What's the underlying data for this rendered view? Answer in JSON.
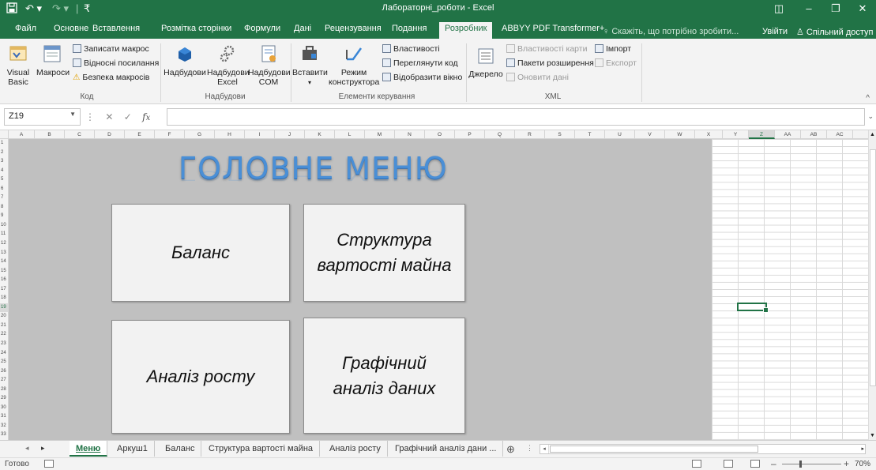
{
  "titlebar": {
    "title": "Лабораторні_роботи - Excel",
    "controls": [
      "◫",
      "–",
      "❐",
      "✕"
    ]
  },
  "tabs": [
    {
      "label": "Файл"
    },
    {
      "label": "Основне"
    },
    {
      "label": "Вставлення"
    },
    {
      "label": "Розмітка сторінки"
    },
    {
      "label": "Формули"
    },
    {
      "label": "Дані"
    },
    {
      "label": "Рецензування"
    },
    {
      "label": "Подання"
    },
    {
      "label": "Розробник",
      "active": true
    },
    {
      "label": "ABBYY PDF Transformer+"
    }
  ],
  "tell_me": "Скажіть, що потрібно зробити...",
  "sign_in": "Увійти",
  "share": "Спільний доступ",
  "ribbon": {
    "code": {
      "label": "Код",
      "visual_basic": "Visual Basic",
      "macros": "Макроси",
      "record_macro": "Записати макрос",
      "relative_refs": "Відносні посилання",
      "macro_security": "Безпека макросів"
    },
    "addins": {
      "label": "Надбудови",
      "addins": "Надбудови",
      "excel_addins": "Надбудови Excel",
      "com_addins": "Надбудови COM"
    },
    "controls": {
      "label": "Елементи керування",
      "insert": "Вставити",
      "design_mode": "Режим конструктора",
      "properties": "Властивості",
      "view_code": "Переглянути код",
      "run_dialog": "Відобразити вікно"
    },
    "xml": {
      "label": "XML",
      "source": "Джерело",
      "map_properties": "Властивості карти",
      "expansion_packs": "Пакети розширення",
      "refresh_data": "Оновити дані",
      "import": "Імпорт",
      "export": "Експорт"
    }
  },
  "formula_bar": {
    "name_box": "Z19",
    "formula": ""
  },
  "columns": [
    "A",
    "B",
    "C",
    "D",
    "E",
    "F",
    "G",
    "H",
    "I",
    "J",
    "K",
    "L",
    "M",
    "N",
    "O",
    "P",
    "Q",
    "R",
    "S",
    "T",
    "U",
    "V",
    "W",
    "X",
    "Y",
    "Z",
    "AA",
    "AB",
    "AC"
  ],
  "rows": [
    "1",
    "2",
    "3",
    "4",
    "5",
    "6",
    "7",
    "8",
    "9",
    "10",
    "11",
    "12",
    "13",
    "14",
    "15",
    "16",
    "17",
    "18",
    "19",
    "20",
    "21",
    "22",
    "23",
    "24",
    "25",
    "26",
    "27",
    "28",
    "29",
    "30",
    "31",
    "32",
    "33"
  ],
  "sheet": {
    "title": "ГОЛОВНЕ МЕНЮ",
    "buttons": {
      "balance": "Баланс",
      "cost_structure": "Структура вартості майна",
      "growth": "Аналіз росту",
      "graphical": "Графічний аналіз даних"
    }
  },
  "sheet_tabs": [
    "Меню",
    "Аркуш1",
    "Баланс",
    "Структура вартості майна",
    "Аналіз росту",
    "Графічний аналіз дани ..."
  ],
  "status": {
    "ready": "Готово",
    "zoom": "70%",
    "zoom_level": 0.7
  },
  "colors": {
    "excel_green": "#217346",
    "menu_title_blue": "#4a8fd6",
    "sheet_background": "#c0c0c0"
  }
}
